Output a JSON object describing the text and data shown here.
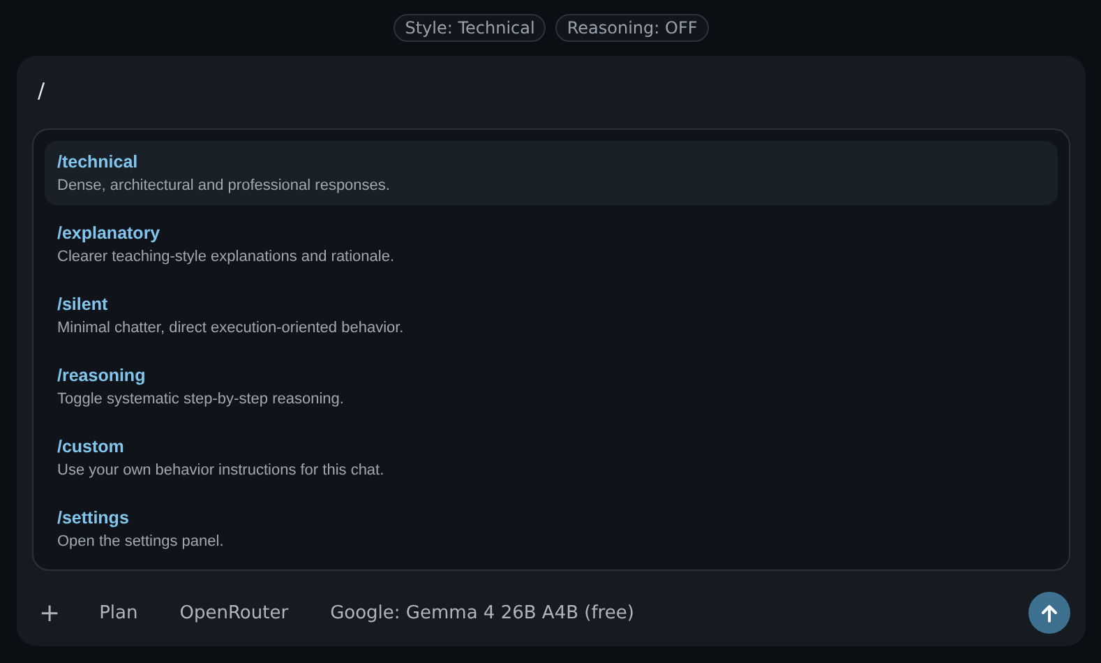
{
  "status_pills": [
    "Style: Technical",
    "Reasoning: OFF"
  ],
  "composer": {
    "value": "/"
  },
  "commands": [
    {
      "name": "/technical",
      "description": "Dense, architectural and professional responses.",
      "selected": true
    },
    {
      "name": "/explanatory",
      "description": "Clearer teaching-style explanations and rationale.",
      "selected": false
    },
    {
      "name": "/silent",
      "description": "Minimal chatter, direct execution-oriented behavior.",
      "selected": false
    },
    {
      "name": "/reasoning",
      "description": "Toggle systematic step-by-step reasoning.",
      "selected": false
    },
    {
      "name": "/custom",
      "description": "Use your own behavior instructions for this chat.",
      "selected": false
    },
    {
      "name": "/settings",
      "description": "Open the settings panel.",
      "selected": false
    }
  ],
  "toolbar": {
    "add": "+",
    "mode": "Plan",
    "provider": "OpenRouter",
    "model": "Google: Gemma 4 26B A4B (free)"
  }
}
